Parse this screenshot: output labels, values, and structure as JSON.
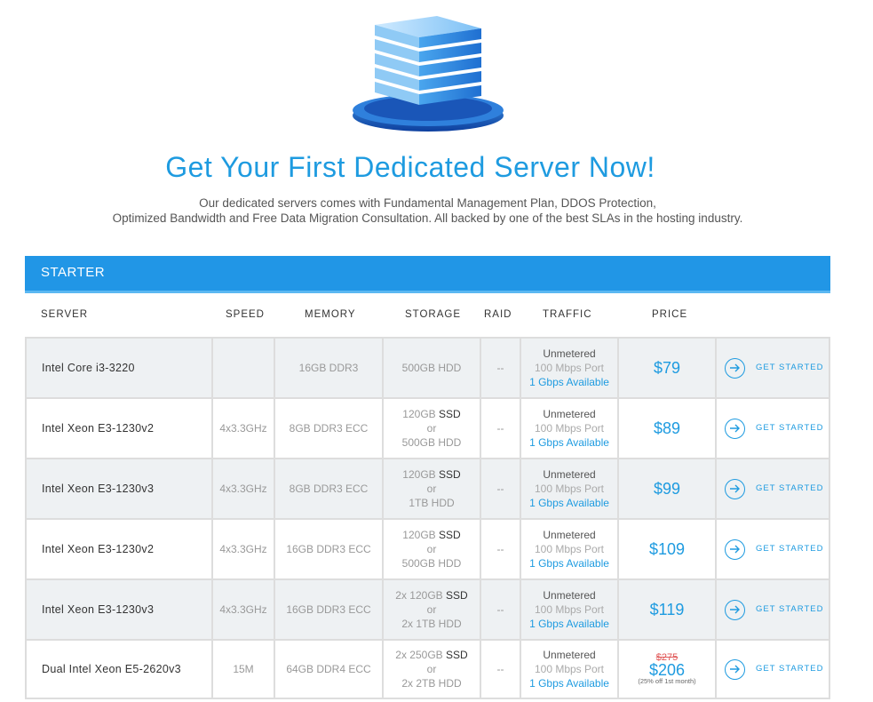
{
  "hero": {
    "title": "Get Your First Dedicated Server Now!",
    "subtitle_line1": "Our dedicated servers comes with Fundamental Management Plan, DDOS Protection,",
    "subtitle_line2": "Optimized Bandwidth and Free Data Migration Consultation. All backed by one of the best SLAs in the hosting industry.",
    "illustration_icon": "server-stack-icon"
  },
  "plan": {
    "name": "STARTER",
    "columns": [
      "SERVER",
      "SPEED",
      "MEMORY",
      "STORAGE",
      "RAID",
      "TRAFFIC",
      "PRICE"
    ],
    "rows": [
      {
        "server": "Intel Core i3-3220",
        "speed": "",
        "memory": "16GB DDR3",
        "storage": [
          "500GB HDD"
        ],
        "raid": "--",
        "traffic_main": "Unmetered",
        "traffic_port": "100 Mbps Port",
        "traffic_avail": "1 Gbps Available",
        "price": "$79",
        "action": "GET STARTED"
      },
      {
        "server": "Intel Xeon E3-1230v2",
        "speed": "4x3.3GHz",
        "memory": "8GB DDR3 ECC",
        "storage_a": "120GB",
        "storage_a_type": "SSD",
        "storage_or": "or",
        "storage_b": "500GB HDD",
        "raid": "--",
        "traffic_main": "Unmetered",
        "traffic_port": "100 Mbps Port",
        "traffic_avail": "1 Gbps Available",
        "price": "$89",
        "action": "GET STARTED"
      },
      {
        "server": "Intel Xeon E3-1230v3",
        "speed": "4x3.3GHz",
        "memory": "8GB DDR3 ECC",
        "storage_a": "120GB",
        "storage_a_type": "SSD",
        "storage_or": "or",
        "storage_b": "1TB HDD",
        "raid": "--",
        "traffic_main": "Unmetered",
        "traffic_port": "100 Mbps Port",
        "traffic_avail": "1 Gbps Available",
        "price": "$99",
        "action": "GET STARTED"
      },
      {
        "server": "Intel Xeon E3-1230v2",
        "speed": "4x3.3GHz",
        "memory": "16GB DDR3 ECC",
        "storage_a": "120GB",
        "storage_a_type": "SSD",
        "storage_or": "or",
        "storage_b": "500GB HDD",
        "raid": "--",
        "traffic_main": "Unmetered",
        "traffic_port": "100 Mbps Port",
        "traffic_avail": "1 Gbps Available",
        "price": "$109",
        "action": "GET STARTED"
      },
      {
        "server": "Intel Xeon E3-1230v3",
        "speed": "4x3.3GHz",
        "memory": "16GB DDR3 ECC",
        "storage_a": "2x 120GB",
        "storage_a_type": "SSD",
        "storage_or": "or",
        "storage_b": "2x 1TB HDD",
        "raid": "--",
        "traffic_main": "Unmetered",
        "traffic_port": "100 Mbps Port",
        "traffic_avail": "1 Gbps Available",
        "price": "$119",
        "action": "GET STARTED"
      },
      {
        "server": "Dual Intel Xeon E5-2620v3",
        "speed": "15M",
        "memory": "64GB DDR4 ECC",
        "storage_a": "2x 250GB",
        "storage_a_type": "SSD",
        "storage_or": "or",
        "storage_b": "2x 2TB HDD",
        "raid": "--",
        "traffic_main": "Unmetered",
        "traffic_port": "100 Mbps Port",
        "traffic_avail": "1 Gbps Available",
        "old_price": "$275",
        "price": "$206",
        "price_note": "(25% off 1st month)",
        "action": "GET STARTED"
      }
    ]
  },
  "colors": {
    "accent": "#1e9be0",
    "header_bg": "#2196e6",
    "old_price": "#e05555"
  }
}
